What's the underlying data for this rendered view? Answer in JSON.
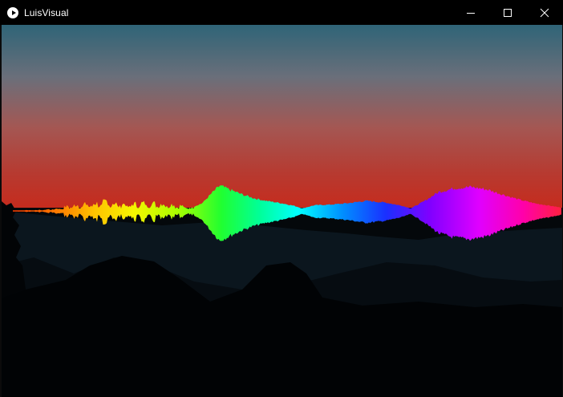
{
  "window": {
    "title": "LuisVisual",
    "icon": "play-icon",
    "controls": {
      "minimize": "minimize-icon",
      "maximize": "maximize-icon",
      "close": "close-icon"
    }
  },
  "colors": {
    "titlebar_bg": "#000000",
    "sky_top": "#2f6477",
    "sky_mid": "#a54d4d",
    "horizon": "#c62c1c",
    "sun": "#ff2f52",
    "ground": "#03070a"
  },
  "visualizer": {
    "style": "mirrored-waveform",
    "hue_gradient": [
      "#ff4a00",
      "#ffb400",
      "#fff000",
      "#a6ff00",
      "#00ff44",
      "#00ffff",
      "#1a4cff",
      "#7c00ff",
      "#ff00cc",
      "#ff2a55"
    ]
  }
}
